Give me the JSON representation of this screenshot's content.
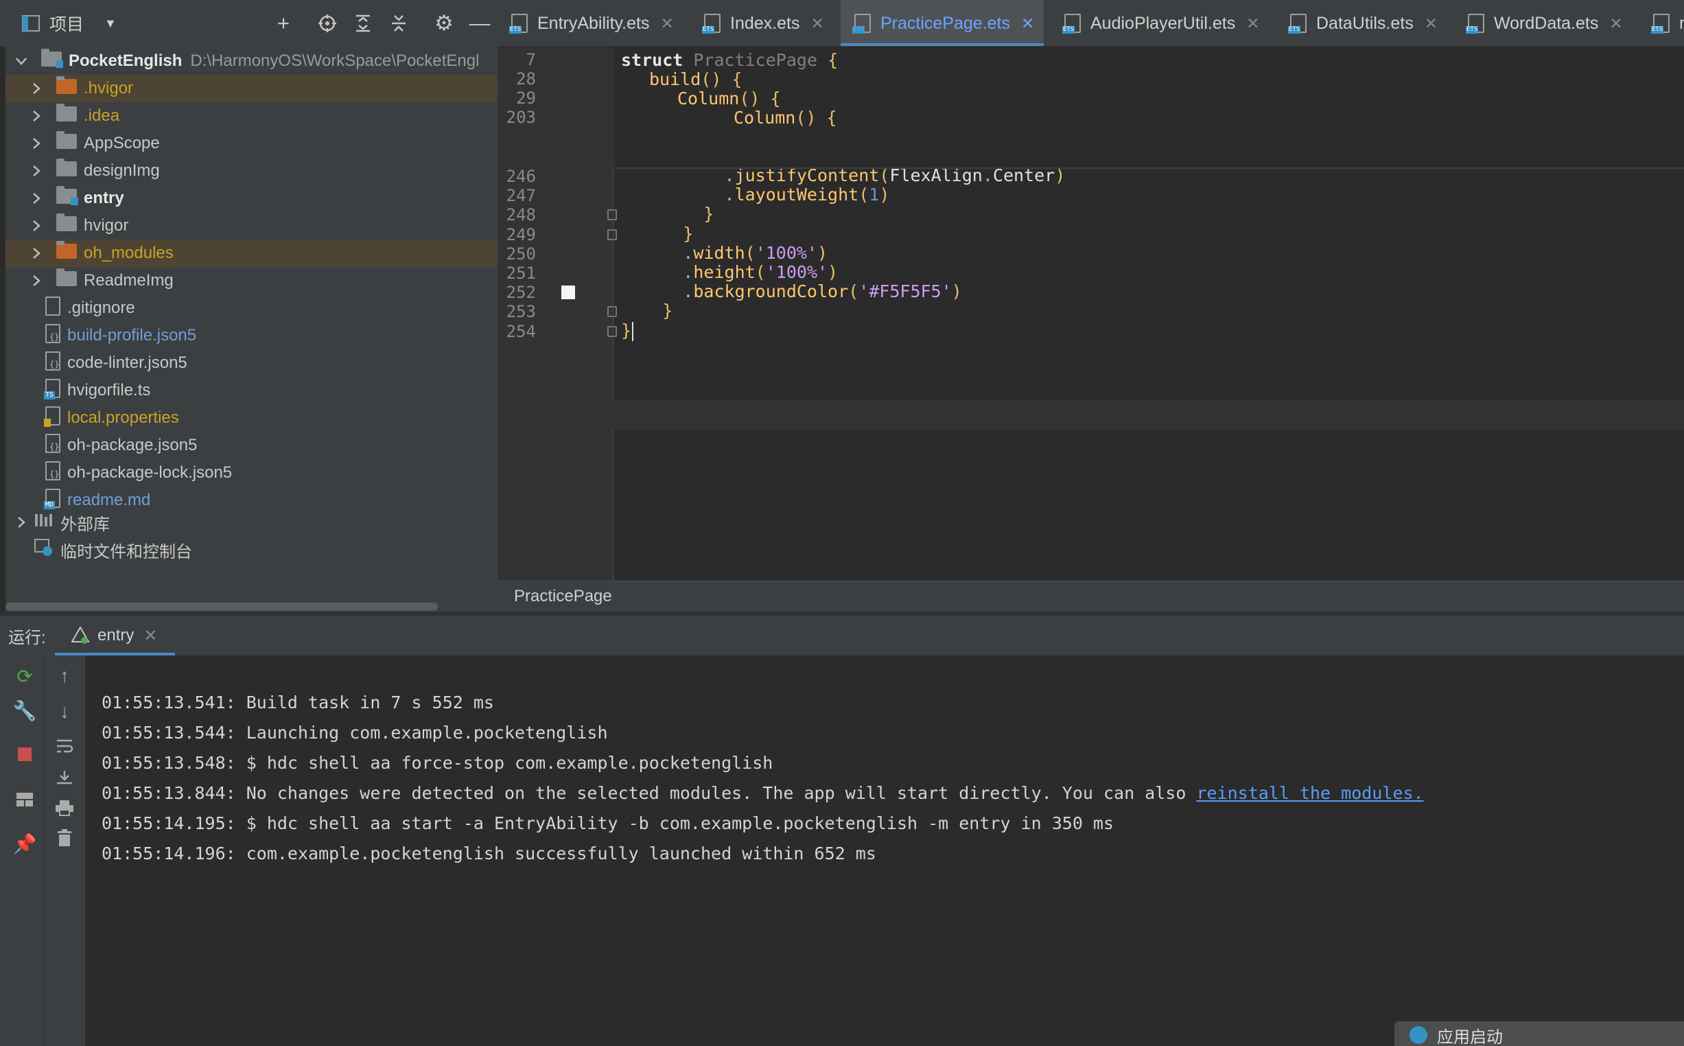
{
  "project_panel": {
    "title": "项目",
    "root": {
      "name": "PocketEnglish",
      "path": "D:\\HarmonyOS\\WorkSpace\\PocketEngl"
    },
    "items": [
      {
        "label": ".hvigor",
        "kind": "folder",
        "color": "#c16628",
        "text_color": "#c9a227",
        "expandable": true,
        "highlight": true
      },
      {
        "label": ".idea",
        "kind": "folder",
        "color": "#8a8d90",
        "text_color": "#c9a227",
        "expandable": true,
        "highlight": false
      },
      {
        "label": "AppScope",
        "kind": "folder",
        "color": "#8a8d90",
        "text_color": "#c8c8c8",
        "expandable": true,
        "highlight": false
      },
      {
        "label": "designImg",
        "kind": "folder",
        "color": "#8a8d90",
        "text_color": "#c8c8c8",
        "expandable": true,
        "highlight": false
      },
      {
        "label": "entry",
        "kind": "module",
        "color": "#8a8d90",
        "text_color": "#e6e6e6",
        "expandable": true,
        "highlight": false,
        "bold": true
      },
      {
        "label": "hvigor",
        "kind": "folder",
        "color": "#8a8d90",
        "text_color": "#c8c8c8",
        "expandable": true,
        "highlight": false
      },
      {
        "label": "oh_modules",
        "kind": "folder",
        "color": "#c16628",
        "text_color": "#c9a227",
        "expandable": true,
        "highlight": true
      },
      {
        "label": "ReadmeImg",
        "kind": "folder",
        "color": "#8a8d90",
        "text_color": "#c8c8c8",
        "expandable": true,
        "highlight": false
      },
      {
        "label": ".gitignore",
        "kind": "file",
        "tag": "",
        "text_color": "#c8c8c8"
      },
      {
        "label": "build-profile.json5",
        "kind": "file",
        "tag": "{}",
        "text_color": "#6e9fd8"
      },
      {
        "label": "code-linter.json5",
        "kind": "file",
        "tag": "{}",
        "text_color": "#c8c8c8"
      },
      {
        "label": "hvigorfile.ts",
        "kind": "file",
        "tag": "TS",
        "text_color": "#c8c8c8"
      },
      {
        "label": "local.properties",
        "kind": "file",
        "tag": "bar",
        "text_color": "#c9a227"
      },
      {
        "label": "oh-package.json5",
        "kind": "file",
        "tag": "{}",
        "text_color": "#c8c8c8"
      },
      {
        "label": "oh-package-lock.json5",
        "kind": "file",
        "tag": "{}",
        "text_color": "#c8c8c8"
      },
      {
        "label": "readme.md",
        "kind": "file",
        "tag": "MD",
        "text_color": "#6e9fd8"
      }
    ],
    "external_libs": "外部库",
    "scratches": "临时文件和控制台"
  },
  "tabs": [
    {
      "label": "EntryAbility.ets",
      "active": false
    },
    {
      "label": "Index.ets",
      "active": false
    },
    {
      "label": "PracticePage.ets",
      "active": true
    },
    {
      "label": "AudioPlayerUtil.ets",
      "active": false
    },
    {
      "label": "DataUtils.ets",
      "active": false
    },
    {
      "label": "WordData.ets",
      "active": false
    },
    {
      "label": "readm",
      "active": false
    }
  ],
  "editor": {
    "sticky_lines": [
      {
        "num": "7",
        "indent": 0,
        "code": "struct PracticePage {"
      },
      {
        "num": "28",
        "indent": 1,
        "code": "build() {"
      },
      {
        "num": "29",
        "indent": 2,
        "code": "Column() {"
      },
      {
        "num": "203",
        "indent": 4,
        "code": "Column() {"
      }
    ],
    "lines": [
      {
        "num": "246",
        "code": "          .justifyContent(FlexAlign.Center)"
      },
      {
        "num": "247",
        "code": "          .layoutWeight(1)"
      },
      {
        "num": "248",
        "code": "        }"
      },
      {
        "num": "249",
        "code": "      }"
      },
      {
        "num": "250",
        "code": "      .width('100%')"
      },
      {
        "num": "251",
        "code": "      .height('100%')"
      },
      {
        "num": "252",
        "code": "      .backgroundColor('#F5F5F5')"
      },
      {
        "num": "253",
        "code": "    }"
      },
      {
        "num": "254",
        "code": "}"
      }
    ],
    "breadcrumb": "PracticePage"
  },
  "run": {
    "label": "运行:",
    "tab": "entry",
    "console": [
      "01:55:13.541: Build task in 7 s 552 ms",
      "01:55:13.544: Launching com.example.pocketenglish",
      "01:55:13.548: $ hdc shell aa force-stop com.example.pocketenglish",
      "01:55:13.844: No changes were detected on the selected modules. The app will start directly. You can also ",
      "01:55:14.195: $ hdc shell aa start -a EntryAbility -b com.example.pocketenglish -m entry in 350 ms",
      "01:55:14.196: com.example.pocketenglish successfully launched within 652 ms"
    ],
    "link_text": "reinstall the modules.",
    "notification": "应用启动"
  }
}
